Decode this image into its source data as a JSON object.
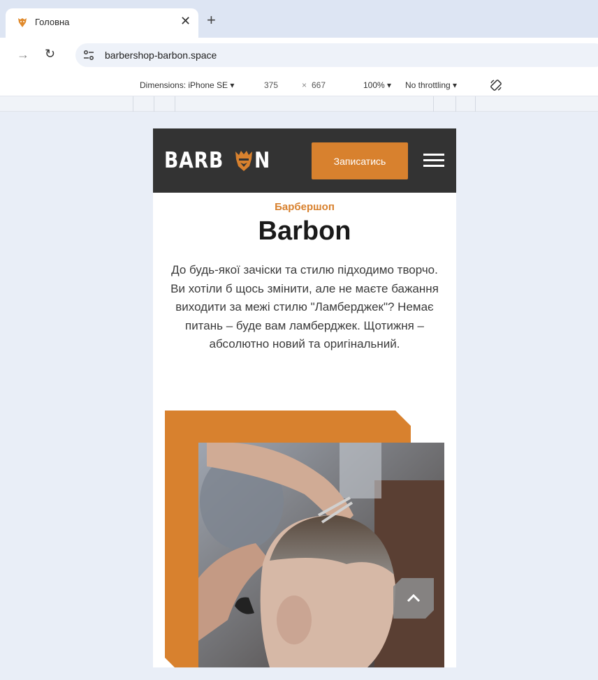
{
  "browser": {
    "tab_title": "Головна",
    "tab_close_glyph": "✕",
    "new_tab_glyph": "+",
    "url": "barbershop-barbon.space",
    "icons": {
      "favicon": "lion-favicon-icon",
      "forward": "forward-arrow-icon",
      "reload": "reload-icon",
      "site_info": "site-settings-icon"
    }
  },
  "devtools": {
    "dimensions_label": "Dimensions: iPhone SE ▾",
    "width": "375",
    "times": "×",
    "height": "667",
    "zoom": "100% ▾",
    "throttling": "No throttling ▾",
    "rotate_icon": "rotate-device-icon"
  },
  "site": {
    "logo_left": "BARB",
    "logo_right": "N",
    "book_button": "Записатись",
    "eyebrow": "Барбершоп",
    "title": "Barbon",
    "description": "До будь-якої зачіски та стилю підходимо творчо. Ви хотіли б щось змінити, але не маєте бажання виходити за межі стилю \"Ламберджек\"? Немає питань – буде вам ламберджек. Щотижня – абсолютно новий та оригінальний.",
    "icons": {
      "menu": "hamburger-menu-icon",
      "scroll_top": "chevron-up-icon",
      "logo_mark": "lion-head-icon"
    }
  },
  "colors": {
    "accent": "#d8812e",
    "header_bg": "#333333",
    "page_bg": "#e9eef7"
  }
}
